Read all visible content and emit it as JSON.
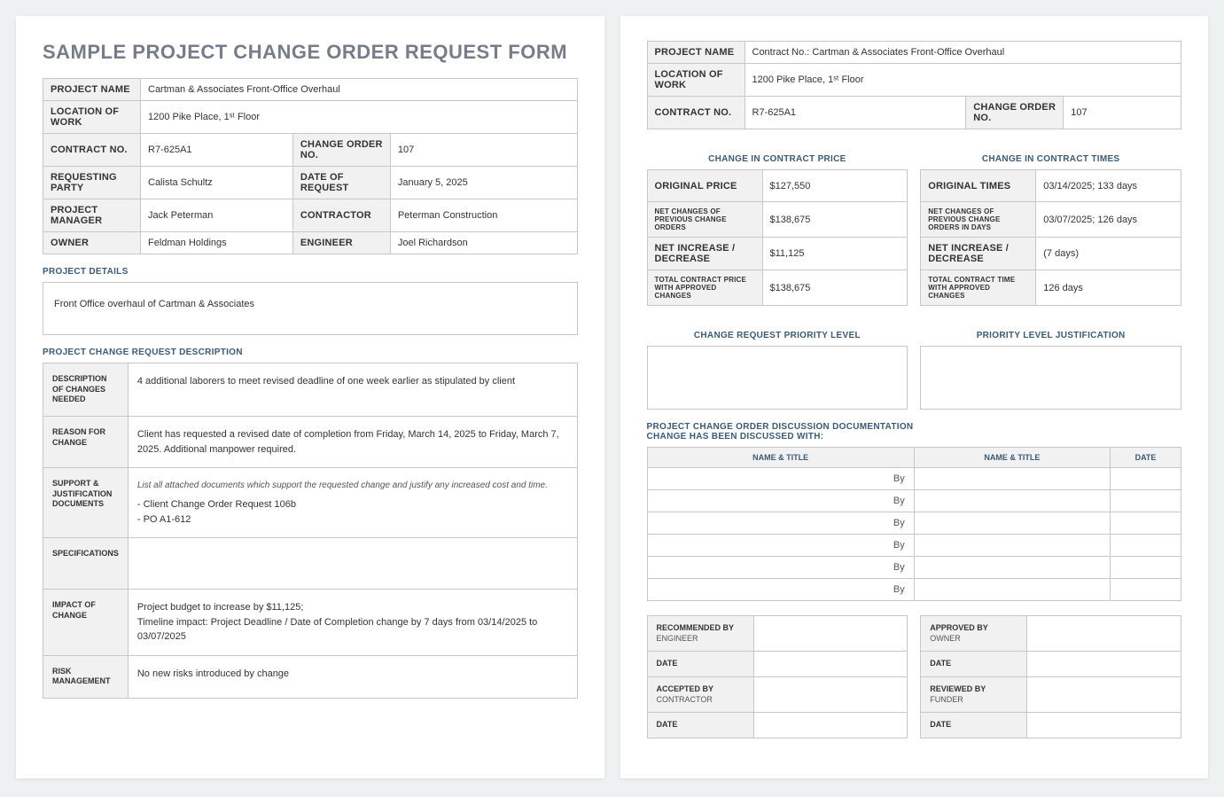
{
  "title": "SAMPLE PROJECT CHANGE ORDER REQUEST FORM",
  "header": {
    "projectNameLabel": "PROJECT NAME",
    "projectName": "Cartman & Associates Front-Office Overhaul",
    "locationLabel": "LOCATION OF WORK",
    "location": "1200 Pike Place, 1ˢᵗ Floor",
    "contractNoLabel": "CONTRACT NO.",
    "contractNo": "R7-625A1",
    "changeOrderNoLabel": "CHANGE ORDER NO.",
    "changeOrderNo": "107",
    "requestingPartyLabel": "REQUESTING PARTY",
    "requestingParty": "Calista Schultz",
    "dateOfRequestLabel": "DATE OF REQUEST",
    "dateOfRequest": "January 5, 2025",
    "projectManagerLabel": "PROJECT MANAGER",
    "projectManager": "Jack Peterman",
    "contractorLabel": "CONTRACTOR",
    "contractor": "Peterman Construction",
    "ownerLabel": "OWNER",
    "owner": "Feldman Holdings",
    "engineerLabel": "ENGINEER",
    "engineer": "Joel Richardson"
  },
  "detailsLabel": "PROJECT DETAILS",
  "details": "Front Office overhaul of Cartman & Associates",
  "changeDescLabel": "PROJECT CHANGE REQUEST DESCRIPTION",
  "desc": {
    "changesNeededLabel": "DESCRIPTION OF CHANGES NEEDED",
    "changesNeeded": "4 additional laborers to meet revised deadline of one week earlier as stipulated by client",
    "reasonLabel": "REASON FOR CHANGE",
    "reason": "Client has requested a revised date of completion from Friday, March 14, 2025 to Friday, March 7, 2025.  Additional manpower required.",
    "supportLabel": "SUPPORT & JUSTIFICATION DOCUMENTS",
    "supportItalic": "List all attached documents which support the requested change and justify any increased cost and time.",
    "support": "- Client Change Order Request 106b\n- PO A1-612",
    "specsLabel": "SPECIFICATIONS",
    "specs": "",
    "impactLabel": "IMPACT OF CHANGE",
    "impact": "Project budget to increase by $11,125;\nTimeline impact: Project Deadline / Date of Completion change by 7 days from 03/14/2025 to 03/07/2025",
    "riskLabel": "RISK MANAGEMENT",
    "risk": "No new risks introduced by change"
  },
  "page2": {
    "projectName": "Contract No.: Cartman & Associates Front-Office Overhaul",
    "priceHeader": "CHANGE IN CONTRACT PRICE",
    "timeHeader": "CHANGE IN CONTRACT TIMES",
    "price": {
      "originalLabel": "ORIGINAL PRICE",
      "original": "$127,550",
      "netPrevLabel": "NET CHANGES OF PREVIOUS CHANGE ORDERS",
      "netPrev": "$138,675",
      "netIncLabel": "NET INCREASE / DECREASE",
      "netInc": "$11,125",
      "totalLabel": "TOTAL CONTRACT PRICE WITH APPROVED CHANGES",
      "total": "$138,675"
    },
    "time": {
      "originalLabel": "ORIGINAL TIMES",
      "original": "03/14/2025; 133 days",
      "netPrevLabel": "NET CHANGES OF PREVIOUS CHANGE ORDERS IN DAYS",
      "netPrev": "03/07/2025; 126 days",
      "netIncLabel": "NET INCREASE / DECREASE",
      "netInc": "(7 days)",
      "totalLabel": "TOTAL CONTRACT TIME WITH APPROVED CHANGES",
      "total": "126 days"
    },
    "priorityLabel": "CHANGE REQUEST PRIORITY LEVEL",
    "priorityJustLabel": "PRIORITY LEVEL JUSTIFICATION",
    "discussLabel": "PROJECT CHANGE ORDER DISCUSSION DOCUMENTATION\nCHANGE HAS BEEN DISCUSSED WITH:",
    "discussCols": {
      "nameTitle": "NAME & TITLE",
      "date": "DATE"
    },
    "by": "By",
    "sig": {
      "recommended": "RECOMMENDED BY",
      "recommendedSub": "ENGINEER",
      "approved": "APPROVED BY",
      "approvedSub": "OWNER",
      "accepted": "ACCEPTED BY",
      "acceptedSub": "CONTRACTOR",
      "reviewed": "REVIEWED BY",
      "reviewedSub": "FUNDER",
      "date": "DATE"
    }
  }
}
